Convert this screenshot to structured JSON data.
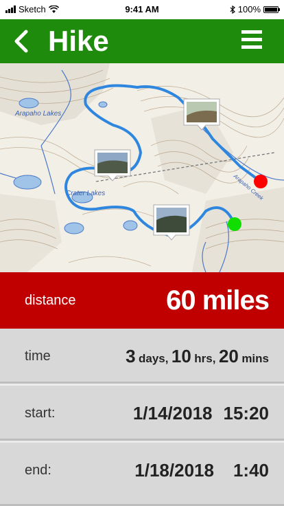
{
  "status_bar": {
    "carrier": "Sketch",
    "time": "9:41 AM",
    "battery": "100%"
  },
  "header": {
    "title": "Hike",
    "back_icon": "chevron-left-icon",
    "menu_icon": "hamburger-menu-icon"
  },
  "map": {
    "labels": {
      "lakes1": "Arapaho Lakes",
      "lakes2": "Crater Lakes",
      "creek": "Arapaho Creek"
    },
    "photo_markers": 3,
    "end_marker_color": "#ff0000",
    "start_marker_color": "#00dd00"
  },
  "distance": {
    "label": "distance",
    "value": "60 miles"
  },
  "time": {
    "label": "time",
    "days": "3",
    "days_unit": "days,",
    "hours": "10",
    "hours_unit": "hrs,",
    "mins": "20",
    "mins_unit": "mins"
  },
  "start": {
    "label": "start:",
    "date": "1/14/2018",
    "clock": "15:20"
  },
  "end": {
    "label": "end:",
    "date": "1/18/2018",
    "clock": "1:40"
  },
  "colors": {
    "header": "#1e8b0c",
    "distance_bg": "#c00000",
    "route": "#2e86de"
  }
}
